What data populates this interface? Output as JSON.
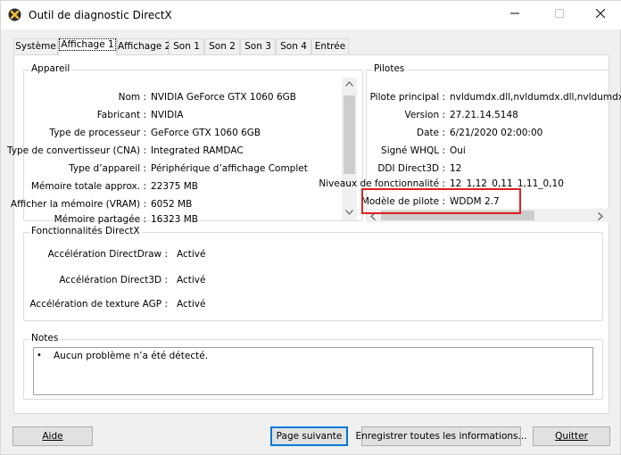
{
  "window": {
    "title": "Outil de diagnostic DirectX",
    "icons": {
      "app": "directx-icon",
      "minimize": "minimize-icon",
      "maximize": "maximize-icon",
      "close": "close-icon"
    }
  },
  "tabs": [
    {
      "label": "Système"
    },
    {
      "label": "Affichage 1",
      "active": true
    },
    {
      "label": "Affichage 2"
    },
    {
      "label": "Son 1"
    },
    {
      "label": "Son 2"
    },
    {
      "label": "Son 3"
    },
    {
      "label": "Son 4"
    },
    {
      "label": "Entrée"
    }
  ],
  "device": {
    "title": "Appareil",
    "rows": [
      {
        "label": "Nom :",
        "value": "NVIDIA GeForce GTX 1060 6GB"
      },
      {
        "label": "Fabricant :",
        "value": "NVIDIA"
      },
      {
        "label": "Type de processeur :",
        "value": "GeForce GTX 1060 6GB"
      },
      {
        "label": "Type de convertisseur (CNA) :",
        "value": "Integrated RAMDAC"
      },
      {
        "label": "Type d’appareil :",
        "value": "Périphérique d’affichage Complet"
      },
      {
        "label": "Mémoire totale approx. :",
        "value": "22375 MB"
      },
      {
        "label": "Afficher la mémoire (VRAM) :",
        "value": "6052 MB"
      },
      {
        "label": "Mémoire partagée :",
        "value": "16323 MB"
      }
    ]
  },
  "drivers": {
    "title": "Pilotes",
    "rows": [
      {
        "label": "Pilote principal :",
        "value": "nvldumdx.dll,nvldumdx.dll,nvldumdx.d"
      },
      {
        "label": "Version :",
        "value": "27.21.14.5148"
      },
      {
        "label": "Date :",
        "value": "6/21/2020 02:00:00"
      },
      {
        "label": "Signé WHQL :",
        "value": "Oui"
      },
      {
        "label": "DDI Direct3D :",
        "value": "12"
      },
      {
        "label": "Niveaux de fonctionnalité :",
        "value": "12_1,12_0,11_1,11_0,10"
      },
      {
        "label": "Modèle de pilote :",
        "value": "WDDM 2.7"
      }
    ]
  },
  "features": {
    "title": "Fonctionnalités DirectX",
    "rows": [
      {
        "label": "Accélération DirectDraw :",
        "value": "Activé"
      },
      {
        "label": "Accélération Direct3D :",
        "value": "Activé"
      },
      {
        "label": "Accélération de texture AGP :",
        "value": "Activé"
      }
    ]
  },
  "notes": {
    "title": "Notes",
    "items": [
      "Aucun problème n’a été détecté."
    ]
  },
  "buttons": {
    "help": "Aide",
    "next": "Page suivante",
    "save_all": "Enregistrer toutes les informations...",
    "quit": "Quitter"
  }
}
